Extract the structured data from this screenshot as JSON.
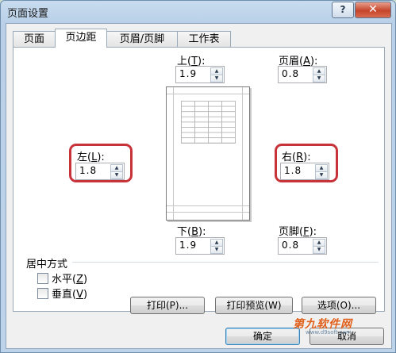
{
  "dialog": {
    "title": "页面设置",
    "help_label": "?",
    "close_label": "✕"
  },
  "tabs": [
    {
      "label": "页面"
    },
    {
      "label": "页边距"
    },
    {
      "label": "页眉/页脚"
    },
    {
      "label": "工作表"
    }
  ],
  "margins": {
    "top": {
      "label_text": "上(",
      "label_key": "T",
      "label_end": "):",
      "value": "1.9"
    },
    "header": {
      "label_text": "页眉(",
      "label_key": "A",
      "label_end": "):",
      "value": "0.8"
    },
    "left": {
      "label_text": "左(",
      "label_key": "L",
      "label_end": "):",
      "value": "1.8"
    },
    "right": {
      "label_text": "右(",
      "label_key": "R",
      "label_end": "):",
      "value": "1.8"
    },
    "bottom": {
      "label_text": "下(",
      "label_key": "B",
      "label_end": "):",
      "value": "1.9"
    },
    "footer": {
      "label_text": "页脚(",
      "label_key": "F",
      "label_end": "):",
      "value": "0.8"
    }
  },
  "centering": {
    "group_label": "居中方式",
    "horizontal": {
      "label_text": "水平(",
      "label_key": "Z",
      "label_end": ")",
      "checked": false
    },
    "vertical": {
      "label_text": "垂直(",
      "label_key": "V",
      "label_end": ")",
      "checked": false
    }
  },
  "buttons": {
    "print": "打印(P)...",
    "print_preview": "打印预览(W)",
    "options": "选项(O)...",
    "ok": "确定",
    "cancel": "取消"
  },
  "watermark": {
    "brand": "第九软件网",
    "url": "www.d9soft.com"
  },
  "colors": {
    "highlight": "#c8333a",
    "close_button": "#c5452b"
  }
}
